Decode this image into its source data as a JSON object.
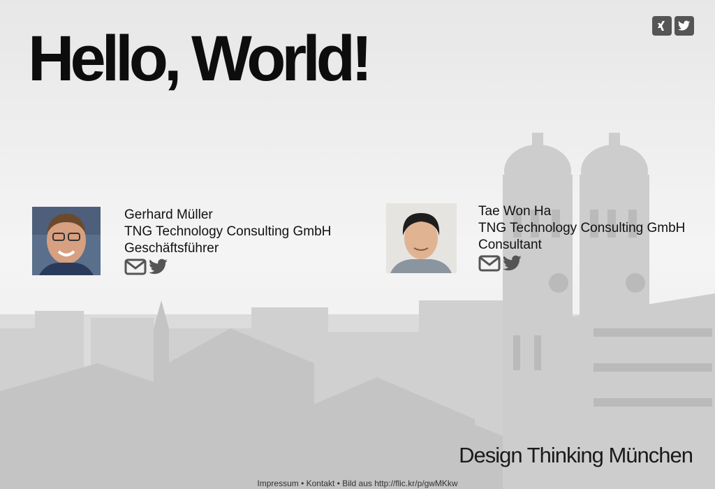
{
  "header": {
    "title": "Hello, World!"
  },
  "social": {
    "xing_icon": "xing-icon",
    "twitter_icon": "twitter-icon"
  },
  "people": [
    {
      "name": "Gerhard Müller",
      "company": "TNG Technology Consulting GmbH",
      "role": "Geschäftsführer"
    },
    {
      "name": "Tae Won Ha",
      "company": "TNG Technology Consulting GmbH",
      "role": "Consultant"
    }
  ],
  "brand": "Design Thinking München",
  "footer": {
    "impressum": "Impressum",
    "sep1": " • ",
    "kontakt": "Kontakt",
    "sep2": " • ",
    "credit": "Bild aus http://flic.kr/p/gwMKkw"
  }
}
